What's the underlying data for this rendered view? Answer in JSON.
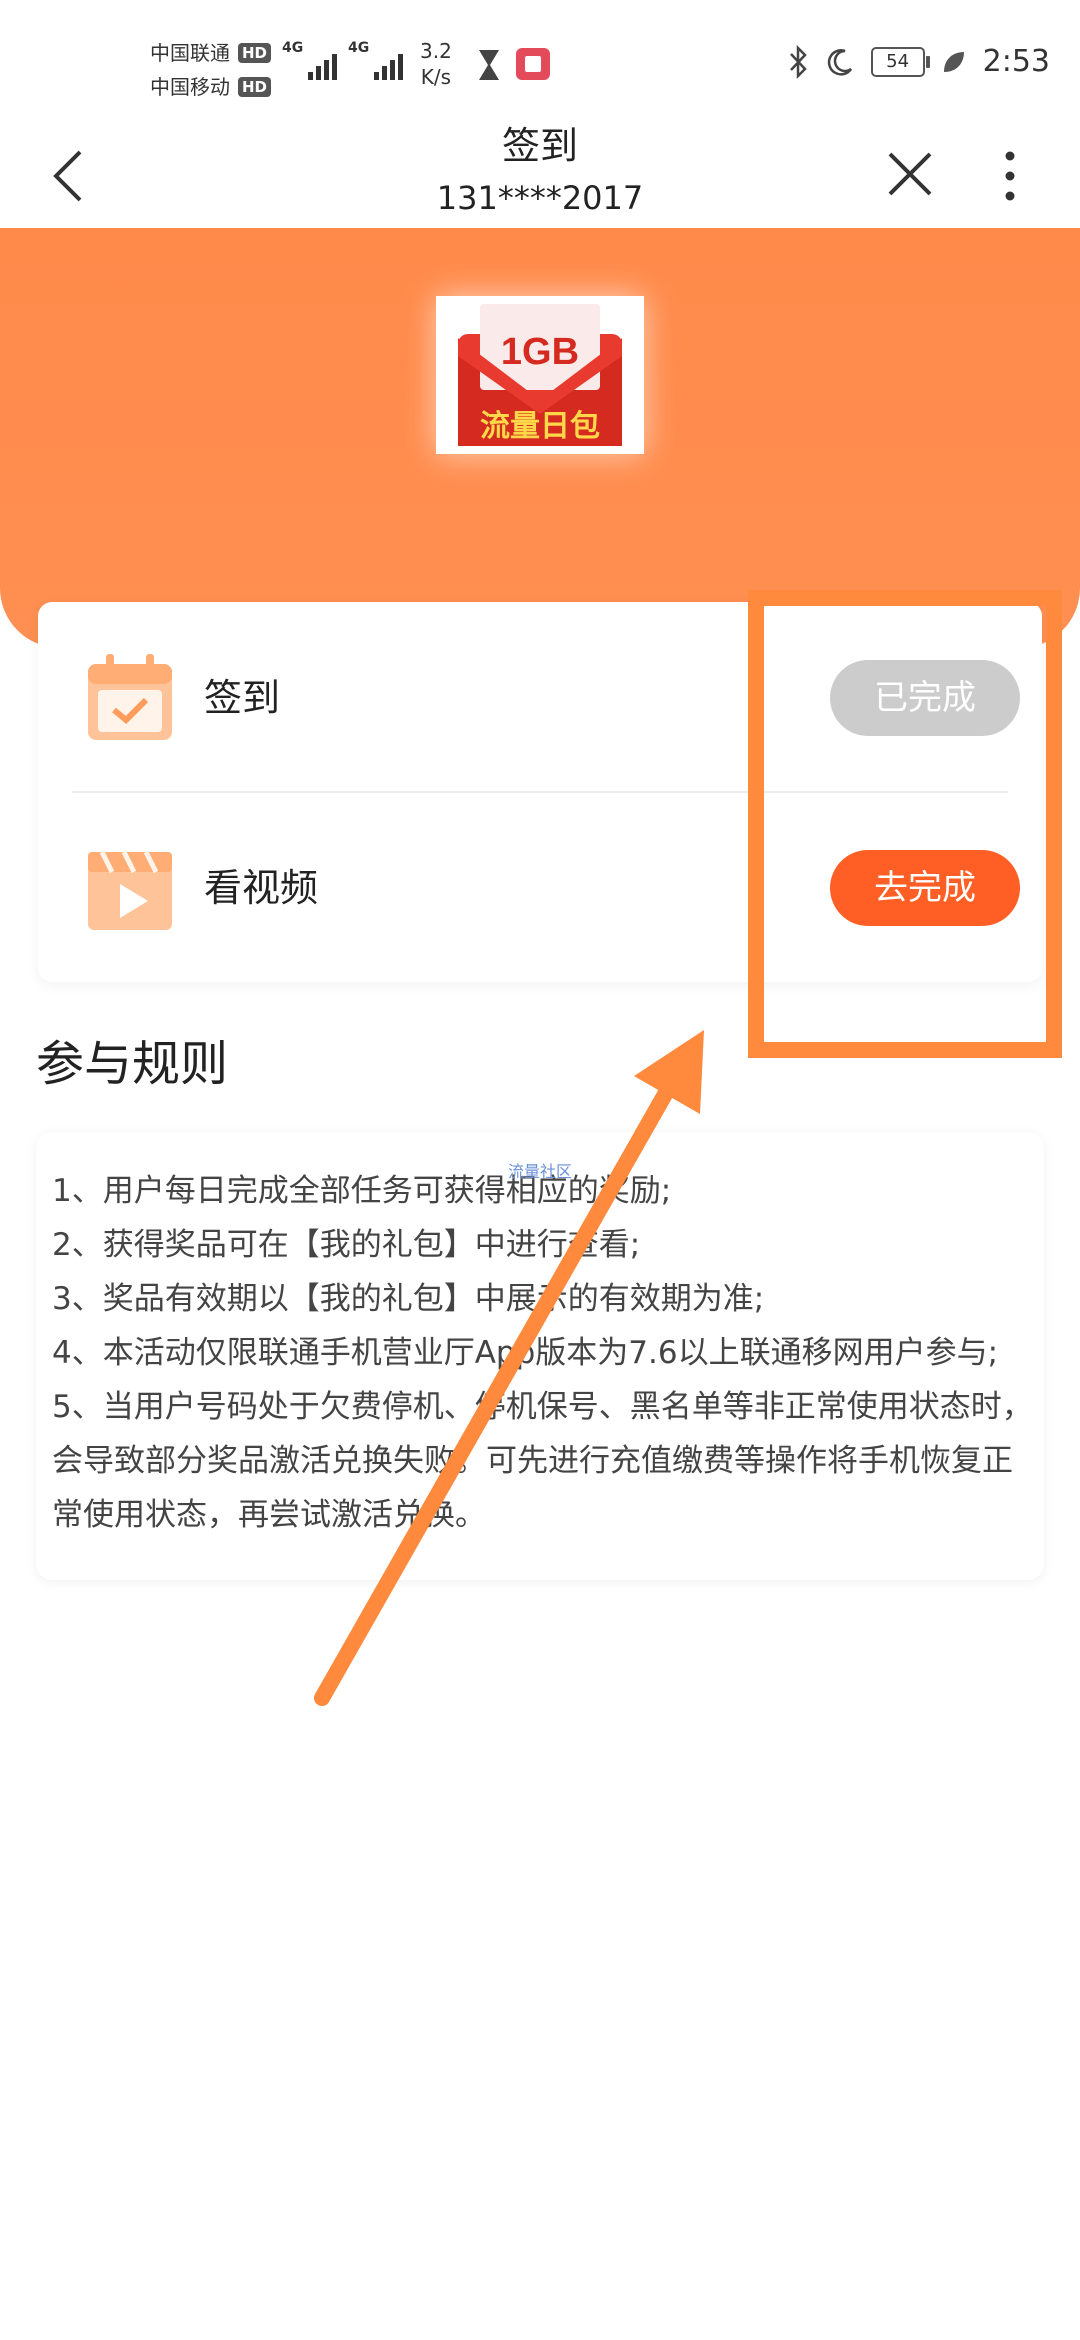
{
  "status_bar": {
    "carrier1": "中国联通",
    "carrier2": "中国移动",
    "hd": "HD",
    "network": "4G",
    "speed_value": "3.2",
    "speed_unit": "K/s",
    "battery": "54",
    "time": "2:53",
    "icons": [
      "hourglass-icon",
      "book-app-icon",
      "bluetooth-icon",
      "moon-icon",
      "leaf-icon"
    ]
  },
  "nav": {
    "title": "签到",
    "subtitle": "131****2017"
  },
  "hero": {
    "badge_top": "1GB",
    "badge_bottom": "流量日包"
  },
  "tasks": [
    {
      "label": "签到",
      "button": "已完成",
      "state": "done",
      "icon": "calendar-check-icon"
    },
    {
      "label": "看视频",
      "button": "去完成",
      "state": "todo",
      "icon": "video-play-icon"
    }
  ],
  "rules": {
    "title": "参与规则",
    "watermark": "流量社区",
    "items": [
      "1、用户每日完成全部任务可获得相应的奖励;",
      "2、获得奖品可在【我的礼包】中进行查看;",
      "3、奖品有效期以【我的礼包】中展示的有效期为准;",
      "4、本活动仅限联通手机营业厅App版本为7.6以上联通移网用户参与;",
      "5、当用户号码处于欠费停机、停机保号、黑名单等非正常使用状态时，会导致部分奖品激活兑换失败。可先进行充值缴费等操作将手机恢复正常使用状态，再尝试激活兑换。"
    ]
  },
  "colors": {
    "hero_orange": "#ff8a4a",
    "button_active": "#ff5f25",
    "button_done": "#cccccc",
    "annotation": "#ff8a3d"
  }
}
